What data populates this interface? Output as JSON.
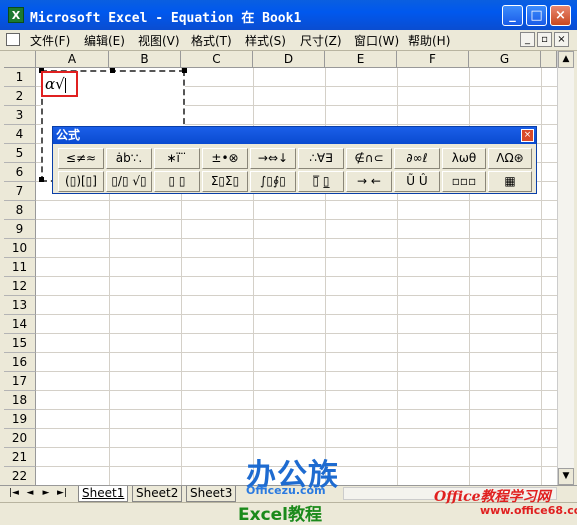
{
  "window": {
    "title": "Microsoft Excel - Equation 在 Book1",
    "app_icon": "X",
    "min": "_",
    "max": "□",
    "close": "×"
  },
  "menu": {
    "items": [
      "文件(F)",
      "编辑(E)",
      "视图(V)",
      "格式(T)",
      "样式(S)",
      "尺寸(Z)",
      "窗口(W)",
      "帮助(H)"
    ],
    "doc_controls": [
      "_",
      "▫",
      "×"
    ]
  },
  "columns": [
    "A",
    "B",
    "C",
    "D",
    "E",
    "F",
    "G"
  ],
  "rows": [
    "1",
    "2",
    "3",
    "4",
    "5",
    "6",
    "7",
    "8",
    "9",
    "10",
    "11",
    "12",
    "13",
    "14",
    "15",
    "16",
    "17",
    "18",
    "19",
    "20",
    "21",
    "22"
  ],
  "equation": {
    "text": "α√"
  },
  "palette": {
    "title": "公式",
    "close": "×",
    "row1": [
      "≤≠≈",
      "ȧb∵.",
      "∗ï ̈ ̇",
      "±•⊗",
      "→⇔↓",
      "∴∀∃",
      "∉∩⊂",
      "∂∞ℓ",
      "λωθ",
      "ΛΩ⊛"
    ],
    "row2": [
      "(▯)[▯]",
      "▯/▯ √▯",
      "▯ ▯",
      "Σ▯Σ▯",
      "∫▯∮▯",
      "▯̅ ▯̲",
      "→ ←",
      "Ũ Û",
      "▫▫▫",
      "▦"
    ]
  },
  "scroll": {
    "up": "▲",
    "down": "▼",
    "left": "◄",
    "right": "►"
  },
  "sheet_nav": [
    "|◄",
    "◄",
    "►",
    "►|"
  ],
  "sheets": [
    {
      "name": "Sheet1",
      "active": true
    },
    {
      "name": "Sheet2",
      "active": false
    },
    {
      "name": "Sheet3",
      "active": false
    }
  ],
  "watermark": {
    "logo": "办公族",
    "site": "Officezu.com",
    "excel": "Excel教程",
    "office_cn": "Office教程学习网",
    "office68": "www.office68.com"
  }
}
